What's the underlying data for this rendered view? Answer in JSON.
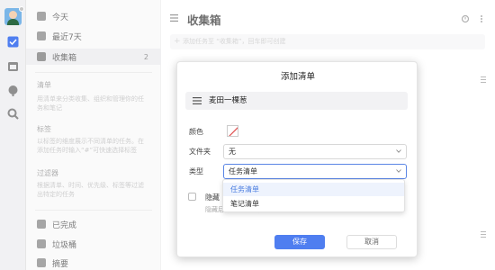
{
  "sidebar": {
    "today": "今天",
    "last7": "最近7天",
    "inbox": "收集箱",
    "inbox_count": "2",
    "lists_head": "清单",
    "lists_desc": "用清单来分类收集、组织和管理你的任务和笔记",
    "tags_head": "标签",
    "tags_desc": "以标签的维度展示不同清单的任务。在添加任务时输入“#”可快速选择标签",
    "filters_head": "过滤器",
    "filters_desc": "根据清单、时间、优先级、标签等过滤出特定的任务",
    "completed": "已完成",
    "trash": "垃圾桶",
    "summary": "摘要"
  },
  "main": {
    "title": "收集箱",
    "add_placeholder": "添加任务至 “收集箱”，回车即可创建"
  },
  "modal": {
    "title": "添加清单",
    "name_value": "麦田一棵葱",
    "color_label": "颜色",
    "folder_label": "文件夹",
    "folder_value": "无",
    "type_label": "类型",
    "type_value": "任务清单",
    "hide_label": "隐藏",
    "hide_desc": "隐藏后，该… 显示，不过任务到期时依然会提醒。",
    "save": "保存",
    "cancel": "取消"
  },
  "dropdown": {
    "options": [
      "任务清单",
      "笔记清单"
    ]
  },
  "colors": {
    "accent": "#4f7ef0",
    "swatch_slash": "#e05050"
  }
}
